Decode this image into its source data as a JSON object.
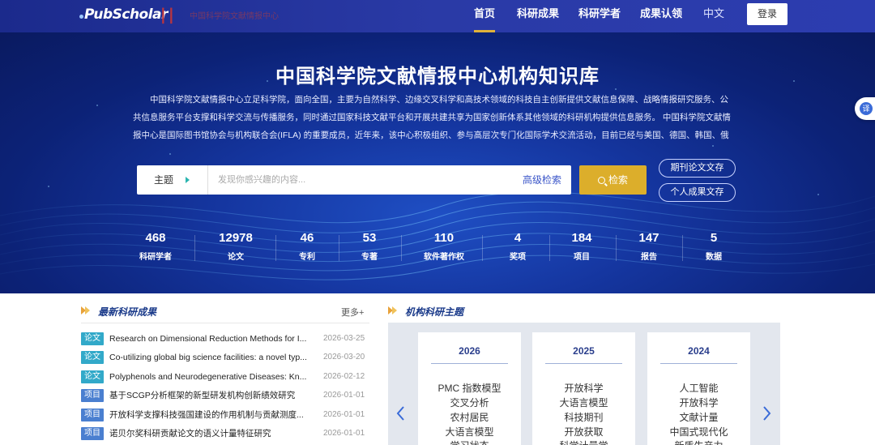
{
  "header": {
    "logo_text": "PubScholar",
    "org_name": "中国科学院文献情报中心",
    "nav": [
      {
        "label": "首页",
        "active": true
      },
      {
        "label": "科研成果",
        "active": false
      },
      {
        "label": "科研学者",
        "active": false
      },
      {
        "label": "成果认领",
        "active": false
      }
    ],
    "lang": "中文",
    "login": "登录"
  },
  "hero": {
    "title": "中国科学院文献情报中心机构知识库",
    "description": "中国科学院文献情报中心立足科学院，面向全国，主要为自然科学、边缘交叉科学和高技术领域的科技自主创新提供文献信息保障、战略情报研究服务、公共信息服务平台支撑和科学交流与传播服务，同时通过国家科技文献平台和开展共建共享为国家创新体系其他领域的科研机构提供信息服务。 中国科学院文献情报中心是国际图书馆协会与机构联合会(IFLA) 的重要成员，近年来，该中心积极组织、参与高层次专门化国际学术交流活动，目前已经与美国、德国、韩国、俄罗斯…",
    "search_type": "主题",
    "search_placeholder": "发现你感兴趣的内容...",
    "advanced_search": "高级检索",
    "search_button": "检索",
    "pill_buttons": [
      "期刊论文文存",
      "个人成果文存"
    ],
    "stats": [
      {
        "num": "468",
        "label": "科研学者"
      },
      {
        "num": "12978",
        "label": "论文"
      },
      {
        "num": "46",
        "label": "专利"
      },
      {
        "num": "53",
        "label": "专著"
      },
      {
        "num": "110",
        "label": "软件著作权"
      },
      {
        "num": "4",
        "label": "奖项"
      },
      {
        "num": "184",
        "label": "项目"
      },
      {
        "num": "147",
        "label": "报告"
      },
      {
        "num": "5",
        "label": "数据"
      }
    ]
  },
  "float_button": "译",
  "latest": {
    "title": "最新科研成果",
    "more": "更多+",
    "items": [
      {
        "tag": "论文",
        "kind": "lunwen",
        "title": "Research on Dimensional Reduction Methods for I...",
        "date": "2026-03-25"
      },
      {
        "tag": "论文",
        "kind": "lunwen",
        "title": "Co-utilizing global big science facilities: a novel typ...",
        "date": "2026-03-20"
      },
      {
        "tag": "论文",
        "kind": "lunwen",
        "title": "Polyphenols and Neurodegenerative Diseases: Kn...",
        "date": "2026-02-12"
      },
      {
        "tag": "项目",
        "kind": "xiangmu",
        "title": "基于SCGP分析框架的新型研发机构创新绩效研究",
        "date": "2026-01-01"
      },
      {
        "tag": "项目",
        "kind": "xiangmu",
        "title": "开放科学支撑科技强国建设的作用机制与贡献测度...",
        "date": "2026-01-01"
      },
      {
        "tag": "项目",
        "kind": "xiangmu",
        "title": "诺贝尔奖科研贡献论文的语义计量特征研究",
        "date": "2026-01-01"
      }
    ]
  },
  "topics": {
    "title": "机构科研主题",
    "cards": [
      {
        "year": "2026",
        "keywords": [
          "PMC 指数模型",
          "交叉分析",
          "农村居民",
          "大语言模型",
          "学习状态"
        ]
      },
      {
        "year": "2025",
        "keywords": [
          "开放科学",
          "大语言模型",
          "科技期刊",
          "开放获取",
          "科学计量学"
        ]
      },
      {
        "year": "2024",
        "keywords": [
          "人工智能",
          "开放科学",
          "文献计量",
          "中国式现代化",
          "新质生产力"
        ]
      }
    ]
  },
  "colors": {
    "header_bg": "#2a3aa6",
    "accent_gold": "#dcae2b",
    "tag_paper": "#32a9c9",
    "tag_project": "#4a7fd0",
    "heading_blue": "#1a3a8a"
  }
}
